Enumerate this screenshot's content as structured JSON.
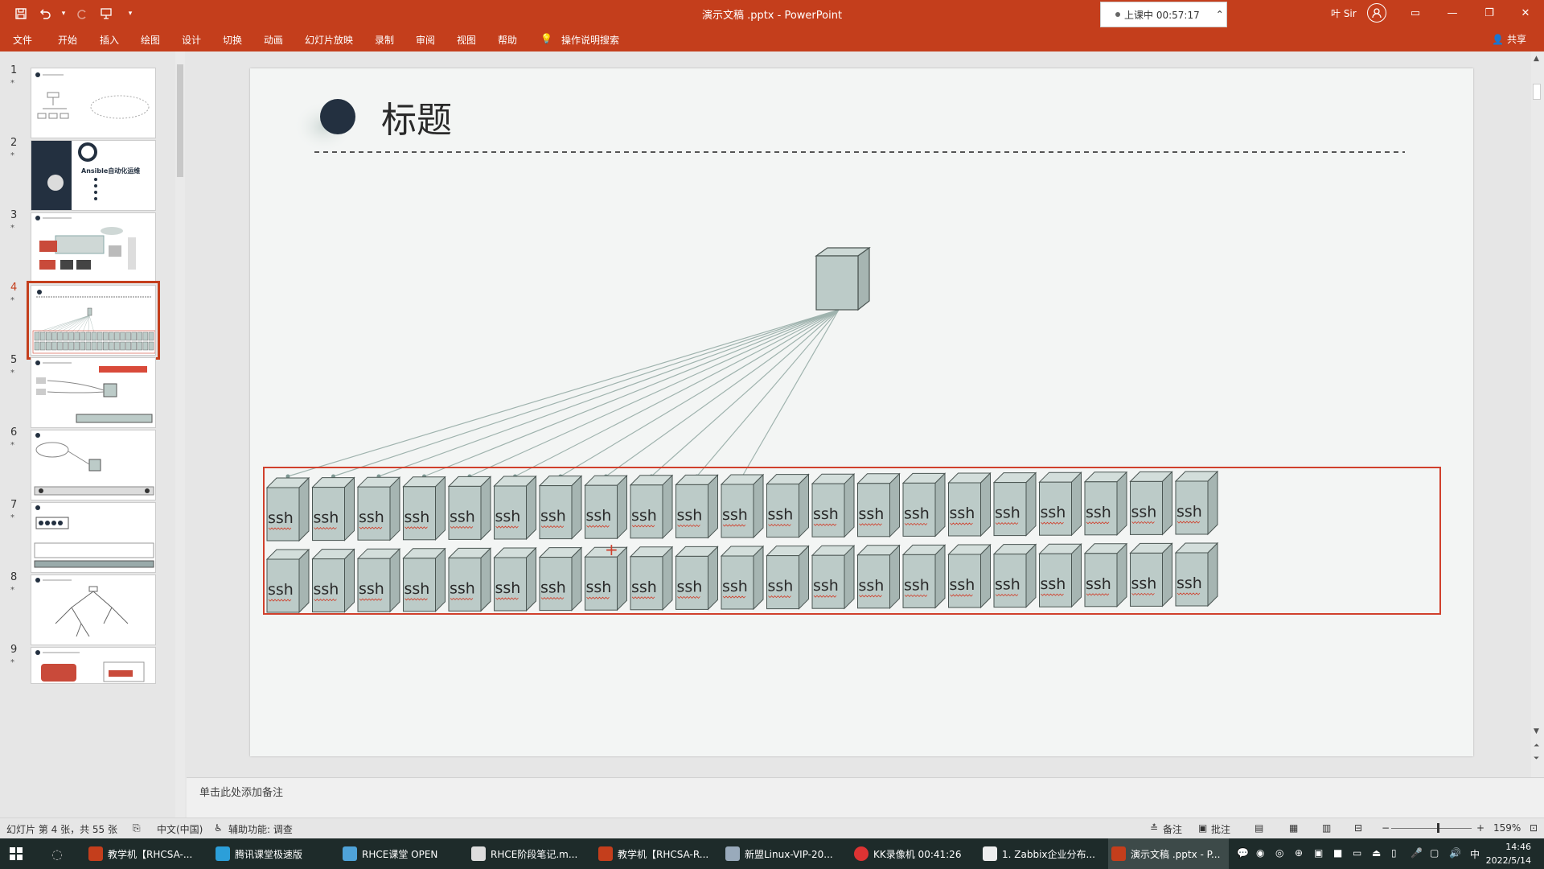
{
  "window": {
    "title": "演示文稿 .pptx  -  PowerPoint",
    "recording": "上课中 00:57:17",
    "user": "叶 Sir"
  },
  "menu": {
    "tabs": [
      "文件",
      "开始",
      "插入",
      "绘图",
      "设计",
      "切换",
      "动画",
      "幻灯片放映",
      "录制",
      "审阅",
      "视图",
      "帮助"
    ],
    "search": "操作说明搜索",
    "share": "共享"
  },
  "slides": {
    "numbers": [
      "1",
      "2",
      "3",
      "4",
      "5",
      "6",
      "7",
      "8",
      "9"
    ],
    "star": "*",
    "selected": "4",
    "thumb2_text": "Ansible自动化运维"
  },
  "slide": {
    "title": "标题",
    "server_label": "ssh",
    "servers_per_row": 21,
    "rows": 2,
    "connected_count": 11
  },
  "notes": {
    "placeholder": "单击此处添加备注"
  },
  "status": {
    "slide_info": "幻灯片 第 4 张，共 55 张",
    "language": "中文(中国)",
    "accessibility": "辅助功能: 调查",
    "notes_btn": "备注",
    "comments_btn": "批注",
    "zoom": "159%"
  },
  "taskbar": {
    "apps": [
      "教学机【RHCSA-...",
      "腾讯课堂极速版",
      "RHCE课堂 OPEN",
      "RHCE阶段笔记.m...",
      "教学机【RHCSA-R...",
      "新盟Linux-VIP-20...",
      "KK录像机 00:41:26",
      "1. Zabbix企业分布...",
      "演示文稿 .pptx - P..."
    ],
    "ime": "中",
    "time": "14:46",
    "date": "2022/5/14"
  },
  "colors": {
    "accent": "#c43e1c",
    "server_fill": "#bccbc8",
    "server_group_border": "#d0402c",
    "title_dot": "#233040"
  }
}
